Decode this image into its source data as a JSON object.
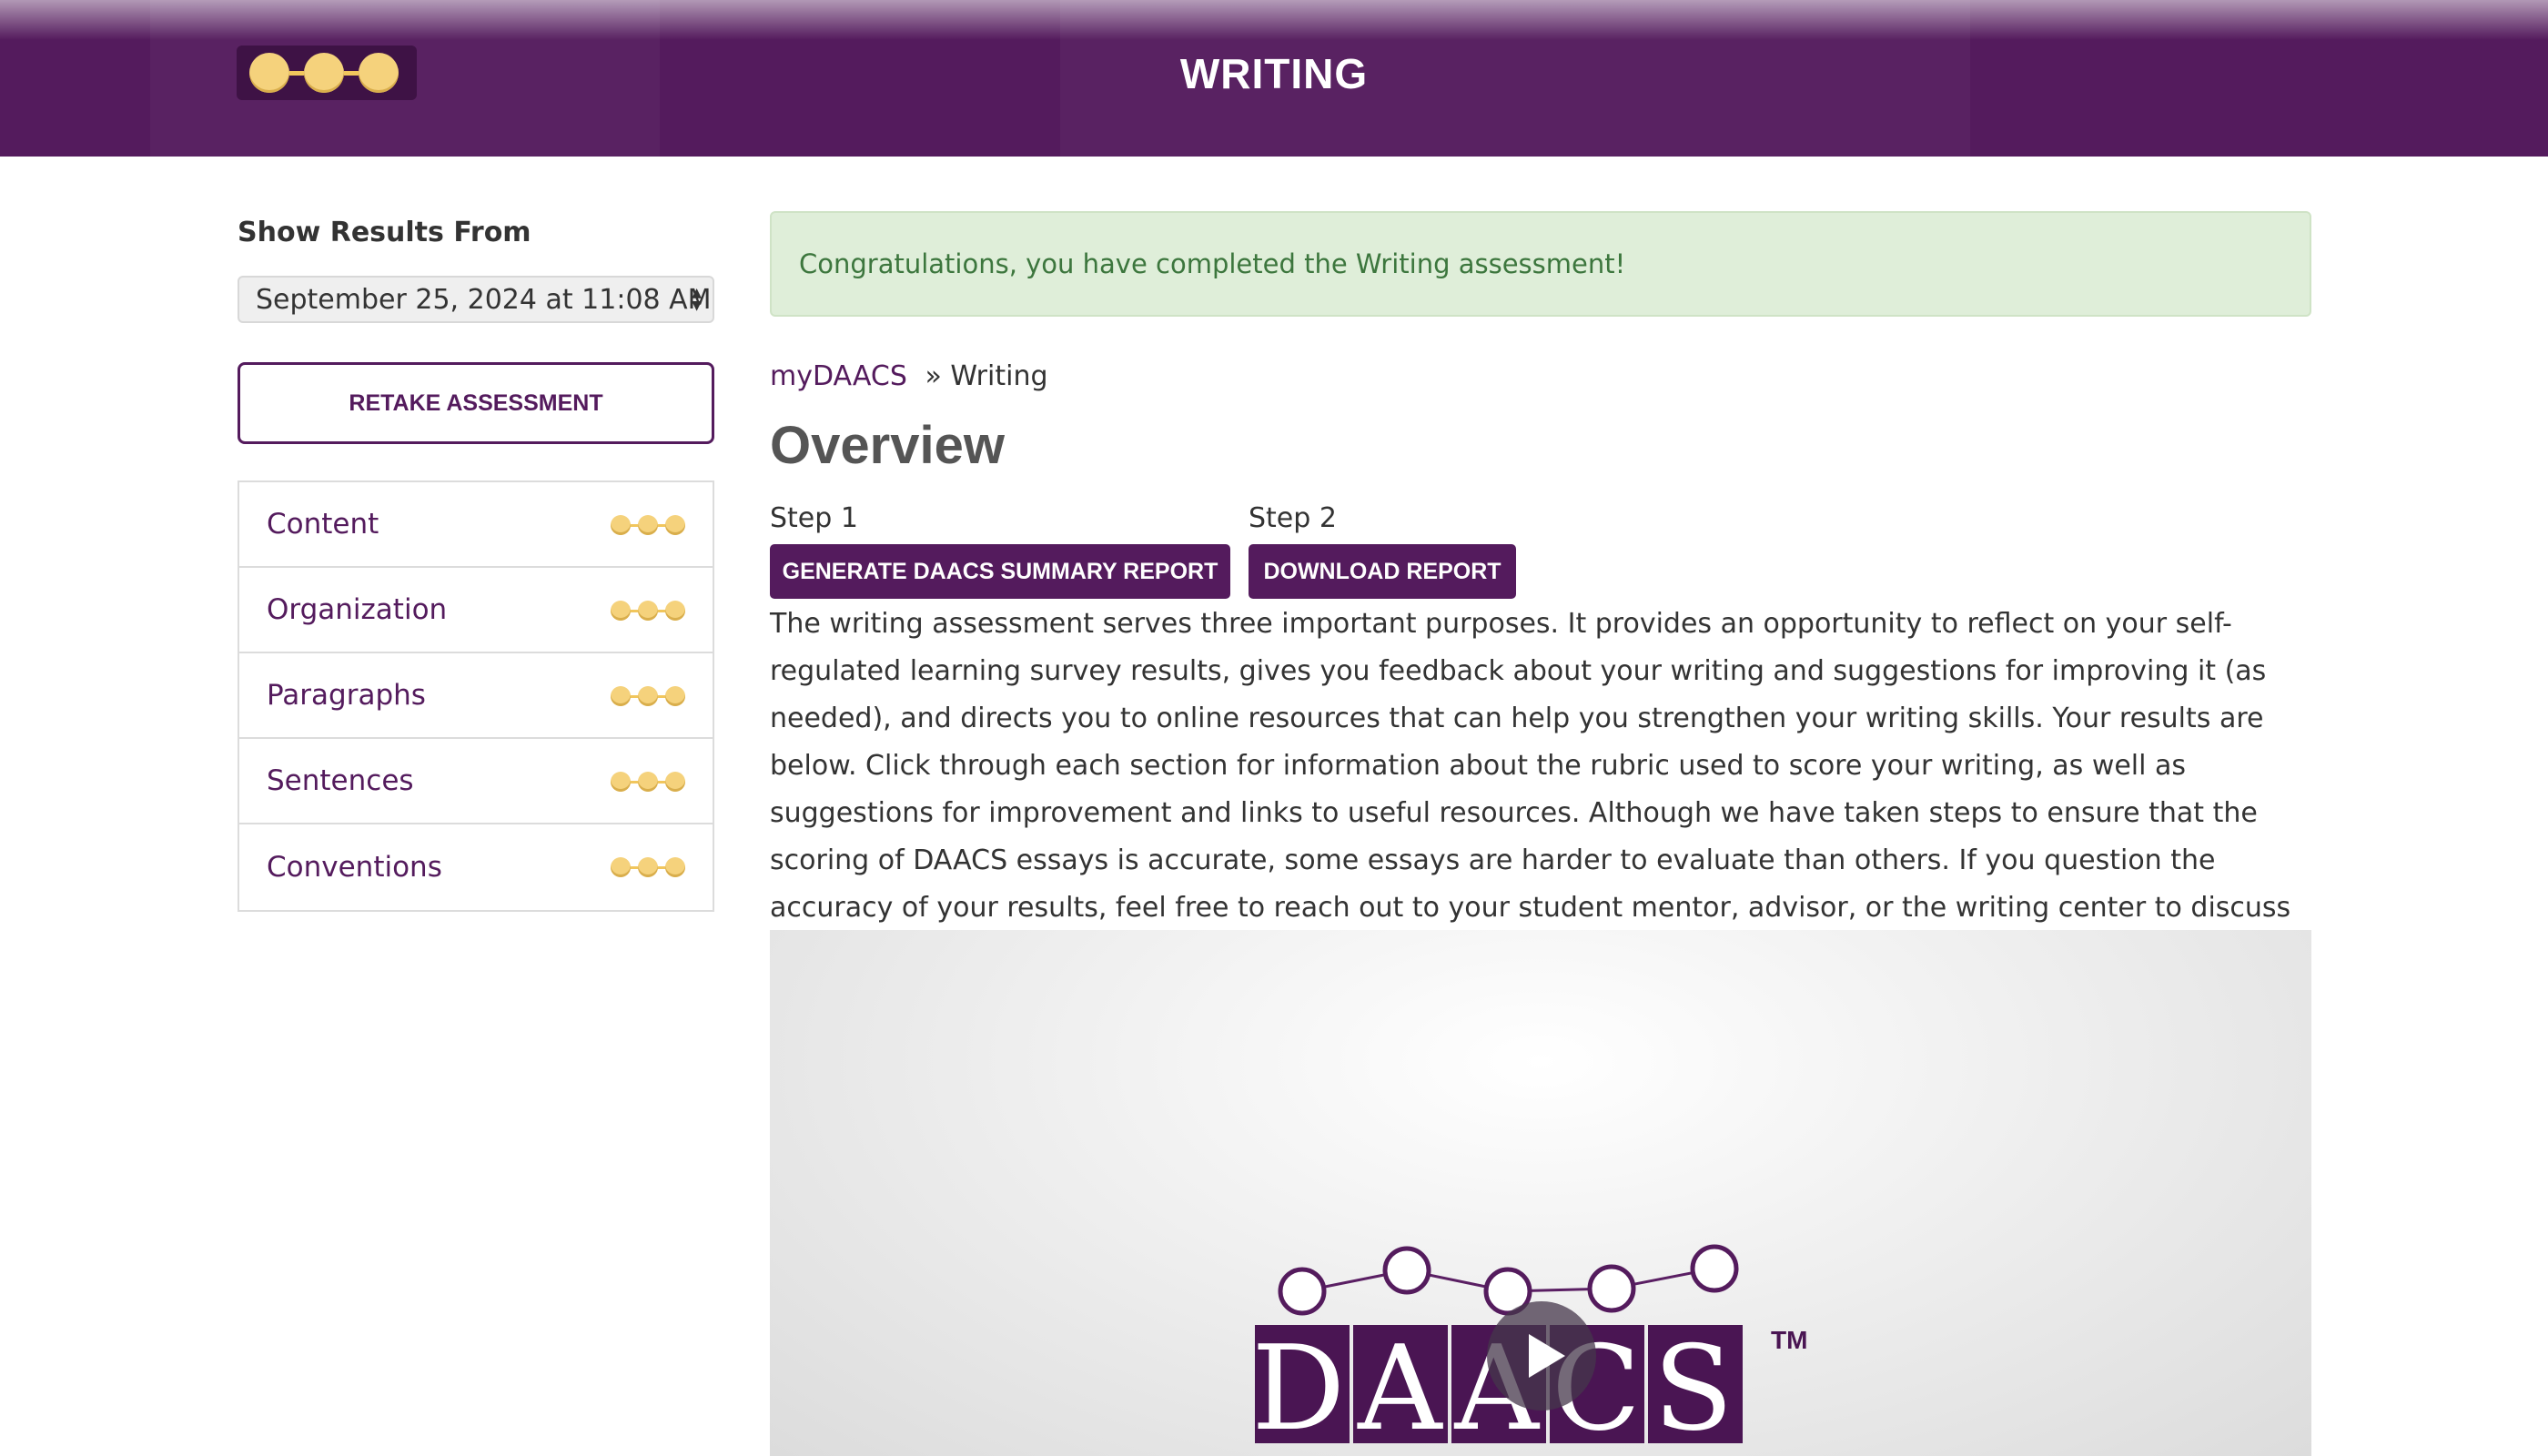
{
  "header": {
    "title": "WRITING",
    "logo_icon": "daacs-dots-logo"
  },
  "colors": {
    "brand_purple": "#541b5d",
    "gold": "#f5d27c",
    "alert_green_bg": "#dfeed9",
    "alert_green_text": "#3c763d"
  },
  "sidebar": {
    "show_results_label": "Show Results From",
    "date_select": {
      "selected": "September 25, 2024 at 11:08 AM"
    },
    "retake_label": "RETAKE ASSESSMENT",
    "items": [
      {
        "label": "Content",
        "icon": "three-dot-score-icon"
      },
      {
        "label": "Organization",
        "icon": "three-dot-score-icon"
      },
      {
        "label": "Paragraphs",
        "icon": "three-dot-score-icon"
      },
      {
        "label": "Sentences",
        "icon": "three-dot-score-icon"
      },
      {
        "label": "Conventions",
        "icon": "three-dot-score-icon"
      }
    ]
  },
  "main": {
    "alert": "Congratulations, you have completed the Writing assessment!",
    "breadcrumb": {
      "link": "myDAACS",
      "separator": "»",
      "current": "Writing"
    },
    "title": "Overview",
    "step1": {
      "label": "Step 1",
      "button": "GENERATE DAACS SUMMARY REPORT"
    },
    "step2": {
      "label": "Step 2",
      "button": "DOWNLOAD REPORT"
    },
    "description": "The writing assessment serves three important purposes. It provides an opportunity to reflect on your self-regulated learning survey results, gives you feedback about your writing and suggestions for improving it (as needed), and directs you to online resources that can help you strengthen your writing skills. Your results are below. Click through each section for information about the rubric used to score your writing, as well as suggestions for improvement and links to useful resources. Although we have taken steps to ensure that the scoring of DAACS essays is accurate, some essays are harder to evaluate than others. If you question the accuracy of your results, feel free to reach out to your student mentor, advisor, or the writing center to discuss your writing.",
    "video": {
      "logo_text": "DAACS",
      "trademark": "TM",
      "play_icon": "play-icon"
    }
  }
}
